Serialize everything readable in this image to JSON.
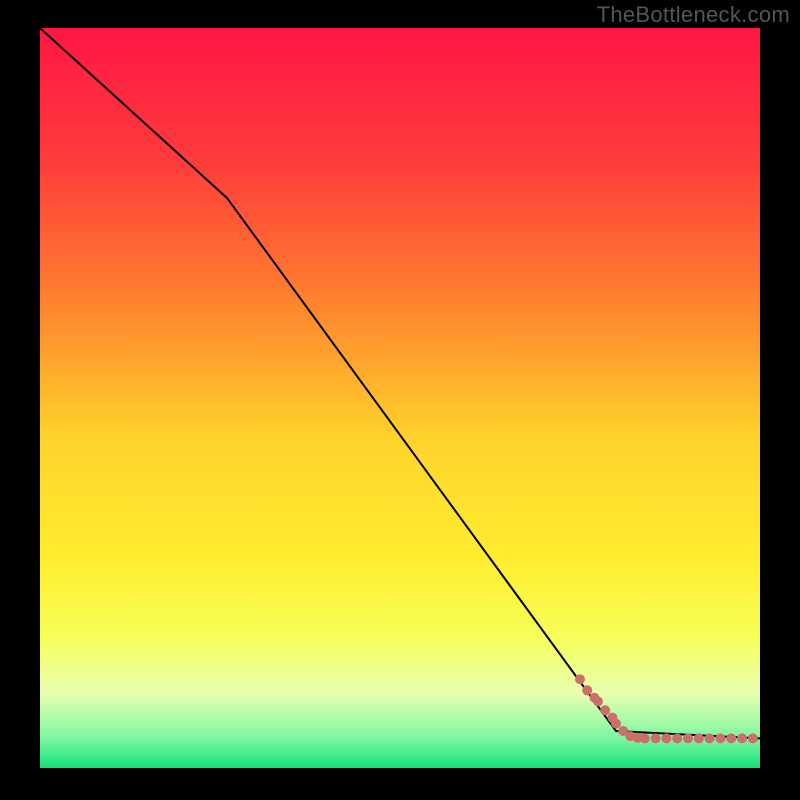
{
  "watermark": "TheBottleneck.com",
  "chart_data": {
    "type": "line",
    "title": "",
    "xlabel": "",
    "ylabel": "",
    "xlim": [
      0,
      100
    ],
    "ylim": [
      0,
      100
    ],
    "gradient_stops": [
      {
        "offset": 0.0,
        "color": "#ff1744"
      },
      {
        "offset": 0.18,
        "color": "#ff3b3b"
      },
      {
        "offset": 0.35,
        "color": "#ff7a2f"
      },
      {
        "offset": 0.55,
        "color": "#ffd12b"
      },
      {
        "offset": 0.72,
        "color": "#ffee30"
      },
      {
        "offset": 0.82,
        "color": "#f7ff56"
      },
      {
        "offset": 0.9,
        "color": "#e8ffb0"
      },
      {
        "offset": 0.96,
        "color": "#7cf7a0"
      },
      {
        "offset": 1.0,
        "color": "#15e07a"
      }
    ],
    "curve": {
      "x": [
        0,
        26,
        80,
        100
      ],
      "y": [
        100,
        77,
        5,
        4
      ]
    },
    "scatter": {
      "color": "#cc6f6a",
      "radius": 5,
      "points": [
        {
          "x": 75,
          "y": 12
        },
        {
          "x": 76,
          "y": 10.5
        },
        {
          "x": 77,
          "y": 9.5
        },
        {
          "x": 77.5,
          "y": 9
        },
        {
          "x": 78.5,
          "y": 7.8
        },
        {
          "x": 79.5,
          "y": 6.8
        },
        {
          "x": 80,
          "y": 6
        },
        {
          "x": 81,
          "y": 5
        },
        {
          "x": 82,
          "y": 4.3
        },
        {
          "x": 83,
          "y": 4.1
        },
        {
          "x": 84,
          "y": 4
        },
        {
          "x": 85.5,
          "y": 4
        },
        {
          "x": 87,
          "y": 4
        },
        {
          "x": 88.5,
          "y": 4
        },
        {
          "x": 90,
          "y": 4
        },
        {
          "x": 91.5,
          "y": 4
        },
        {
          "x": 93,
          "y": 4
        },
        {
          "x": 94.5,
          "y": 4
        },
        {
          "x": 96,
          "y": 4
        },
        {
          "x": 97.5,
          "y": 4
        },
        {
          "x": 99,
          "y": 4
        }
      ]
    }
  }
}
